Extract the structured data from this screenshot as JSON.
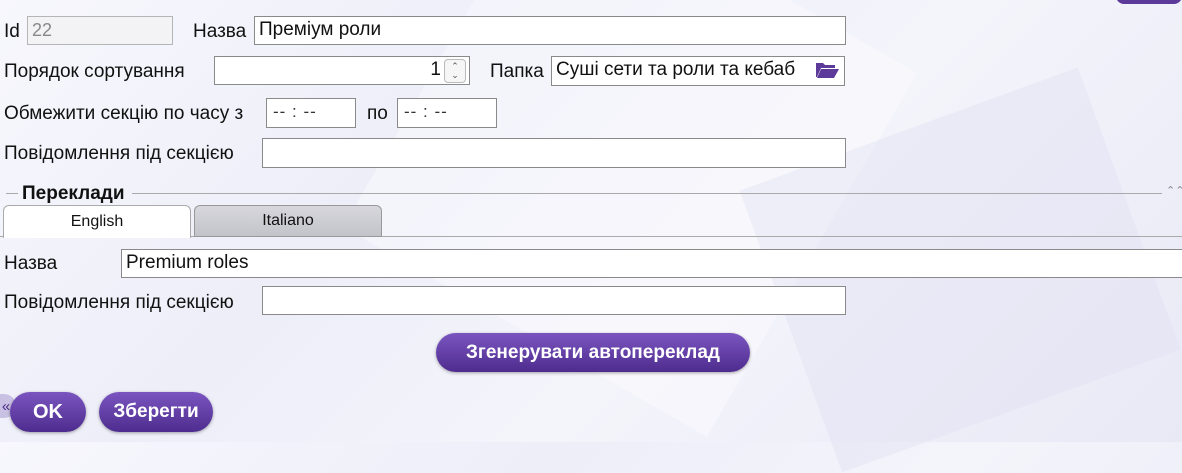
{
  "labels": {
    "id": "Id",
    "name": "Назва",
    "sort_order": "Порядок сортування",
    "folder": "Папка",
    "time_limit": "Обмежити секцію по часу з",
    "time_to": "по",
    "section_message": "Повідомлення під секцією"
  },
  "fields": {
    "id_value": "22",
    "name_value": "Преміум роли",
    "sort_order_value": "1",
    "folder_value": "Суші сети та роли та кебаб",
    "time_from_placeholder": "-- : --",
    "time_to_placeholder": "-- : --",
    "section_message_value": ""
  },
  "translations": {
    "title": "Переклади",
    "tabs": [
      {
        "label": "English",
        "active": true
      },
      {
        "label": "Italiano",
        "active": false
      }
    ],
    "name_label": "Назва",
    "name_value": "Premium roles",
    "message_label": "Повідомлення під секцією",
    "message_value": "",
    "generate_button": "Згенерувати автопереклад"
  },
  "footer": {
    "ok_button": "OK",
    "save_button": "Зберегти",
    "collapse_glyph": "«"
  },
  "colors": {
    "accent": "#5b3a99",
    "button_top": "#7a55c0",
    "button_bottom": "#4e2c8e"
  },
  "icons": [
    "folder-open-icon",
    "spinner-arrows-icon",
    "collapse-up-icon",
    "collapse-left-icon"
  ]
}
